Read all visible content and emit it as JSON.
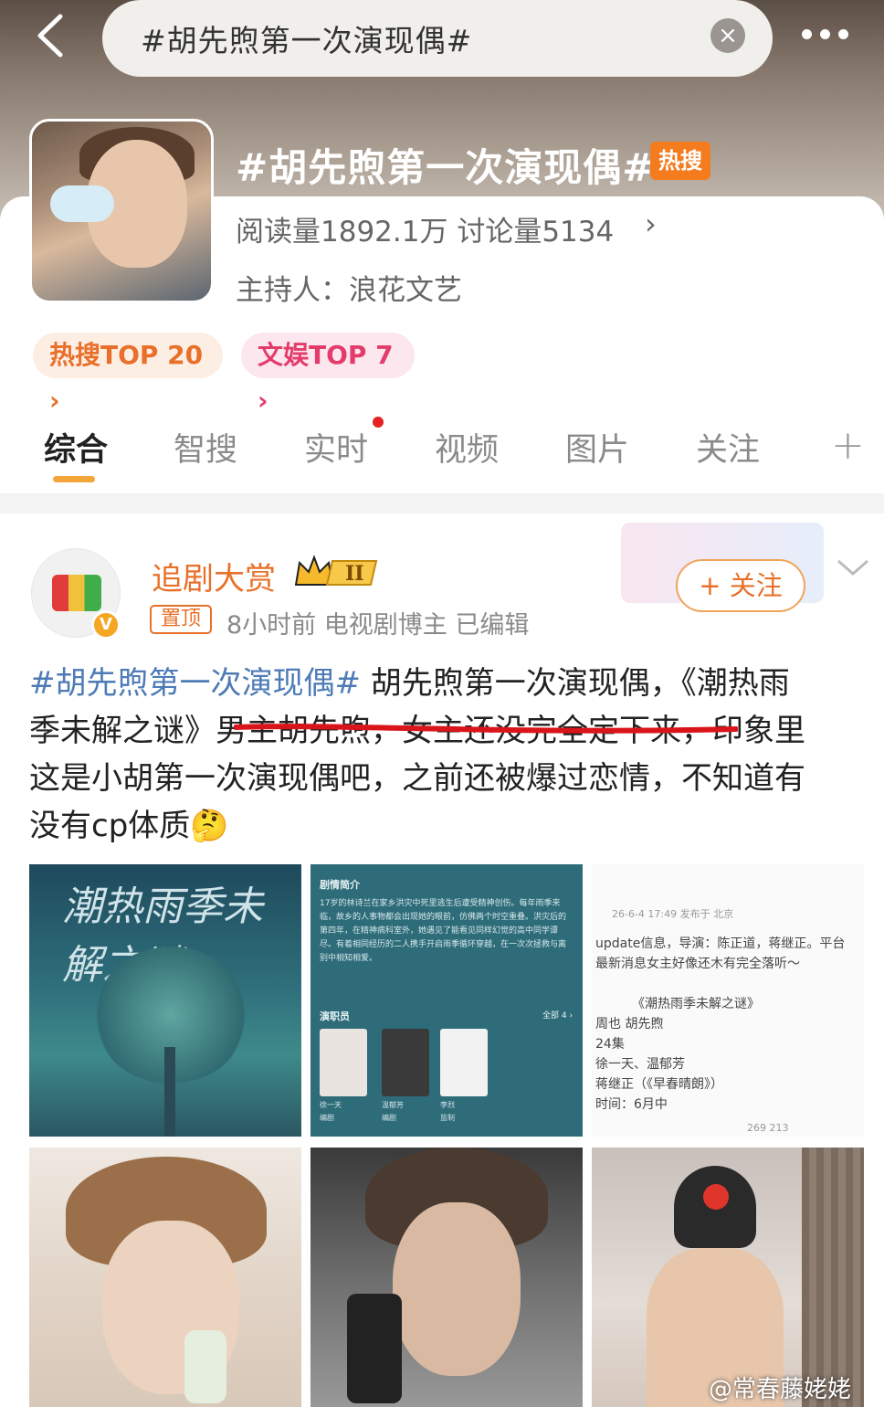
{
  "header": {
    "search_query": "#胡先煦第一次演现偶#",
    "clear_icon": "close-icon",
    "more_icon": "more-dots-icon",
    "back_icon": "back-arrow-icon"
  },
  "topic": {
    "title": "#胡先煦第一次演现偶#",
    "hot_badge": "热搜",
    "stats": "阅读量1892.1万  讨论量5134",
    "host": "主持人：浪花文艺",
    "rank_pills": [
      "热搜TOP 20 ›",
      "文娱TOP 7 ›"
    ]
  },
  "tabs": [
    "综合",
    "智搜",
    "实时",
    "视频",
    "图片",
    "关注"
  ],
  "active_tab": "综合",
  "post": {
    "author": "追剧大赏",
    "pinned": "置顶",
    "meta": "8小时前   电视剧博主   已编辑",
    "follow_label": "+ 关注",
    "hashtag": "#胡先煦第一次演现偶#",
    "body_line1": " 胡先煦第一次演现偶，《潮热雨",
    "body_line2": "季未解之谜》男主胡先煦，女主还没完全定下来，印象里",
    "body_line3": "这是小胡第一次演现偶吧，之前还被爆过恋情，不知道有",
    "body_line4": "没有cp体质🤔"
  },
  "images": {
    "poster_title": "潮热雨季未解之谜",
    "synopsis_heading": "剧情简介",
    "synopsis_text": "17岁的林诗兰在家乡洪灾中死里逃生后遭受精神创伤。每年雨季来临，故乡的人事物都会出现她的眼前，仿佛两个时空重叠。洪灾后的第四年，在精神病科室外，她遇见了能看见同样幻觉的高中同学谭尽。有着相同经历的二人携手开启雨季循环穿越，在一次次拯救与离别中相知相爱。",
    "cast_heading": "演职员",
    "cast_all": "全部 4 ›",
    "cast_names": [
      "徐一天",
      "温郁芳",
      "李烈"
    ],
    "cast_roles": [
      "编剧",
      "编剧",
      "监制"
    ],
    "screenshot_lines": [
      "26-6-4 17:49  发布于 北京",
      "update信息，导演：陈正道，蒋继正。平台",
      "最新消息女主好像还木有完全落听～",
      "《潮热雨季未解之谜》",
      "周也 胡先煦",
      "24集",
      "徐一天、温郁芳",
      "蒋继正（《早春晴朗》）",
      "时间：6月中",
      "269    213"
    ]
  },
  "watermark": "@常春藤姥姥",
  "colors": {
    "accent_orange": "#e8702a",
    "hashtag_blue": "#4e7bb6",
    "tab_underline": "#f3a53a",
    "hot_badge": "#f47c1f"
  }
}
